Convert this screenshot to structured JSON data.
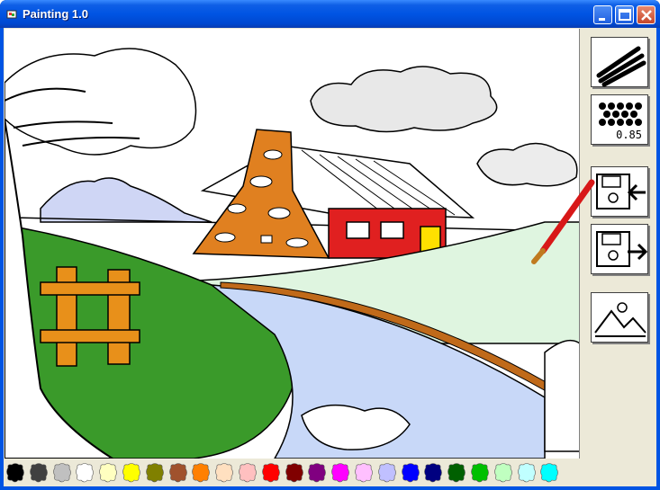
{
  "window": {
    "title": "Painting 1.0",
    "controls": [
      "minimize-button",
      "maximize-button",
      "close-button"
    ]
  },
  "toolbar": {
    "tools": [
      {
        "name": "brush-tool",
        "icon": "brush-strokes-icon"
      },
      {
        "name": "spray-tool",
        "icon": "spray-dots-icon",
        "value_label": "0.85"
      },
      {
        "name": "open-file-tool",
        "icon": "floppy-open-icon"
      },
      {
        "name": "save-file-tool",
        "icon": "floppy-save-icon"
      },
      {
        "name": "new-picture-tool",
        "icon": "landscape-picture-icon"
      }
    ]
  },
  "palette": {
    "colors": [
      "#000000",
      "#404040",
      "#c0c0c0",
      "#ffffff",
      "#ffffc0",
      "#ffff00",
      "#808000",
      "#a0522d",
      "#ff8000",
      "#ffe0c0",
      "#ffc0c0",
      "#ff0000",
      "#800000",
      "#800080",
      "#ff00ff",
      "#ffc0ff",
      "#c0c0ff",
      "#0000ff",
      "#000080",
      "#006000",
      "#00c000",
      "#c0ffc0",
      "#c0ffff",
      "#00ffff"
    ]
  },
  "canvas": {
    "description_icon": "coloring-landscape-drawing",
    "colors": {
      "grass": "#3a9a2a",
      "grass_light": "#dff5e0",
      "river": "#c8d8f8",
      "house_red": "#e02020",
      "tower_orange": "#e08020",
      "door_yellow": "#ffe000",
      "fence_orange": "#e8901a",
      "mountain": "#c0c8f0"
    }
  }
}
